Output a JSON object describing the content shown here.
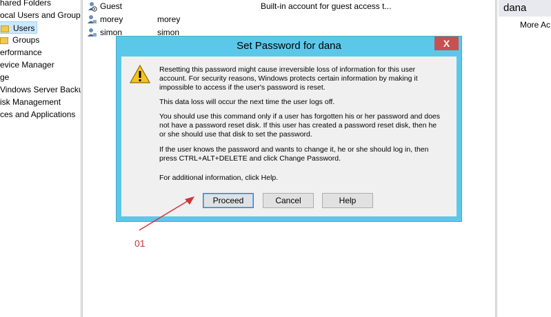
{
  "tree": {
    "items": [
      {
        "label": "hared Folders"
      },
      {
        "label": "ocal Users and Groups"
      },
      {
        "label": "Users"
      },
      {
        "label": "Groups"
      },
      {
        "label": "erformance"
      },
      {
        "label": "evice Manager"
      },
      {
        "label": "ge"
      },
      {
        "label": "Vindows Server Backup"
      },
      {
        "label": "isk Management"
      },
      {
        "label": "ces and Applications"
      }
    ]
  },
  "users": [
    {
      "name": "Guest",
      "full_name": "",
      "description": "Built-in account for guest access t..."
    },
    {
      "name": "morey",
      "full_name": "morey",
      "description": ""
    },
    {
      "name": "simon",
      "full_name": "simon",
      "description": ""
    }
  ],
  "actions": {
    "header": "dana",
    "more": "More Ac"
  },
  "dialog": {
    "title": "Set Password for dana",
    "close": "X",
    "paragraphs": [
      "Resetting this password might cause irreversible loss of information for this user account. For security reasons, Windows protects certain information by making it impossible to access if the user's password is reset.",
      "This data loss will occur the next time the user logs off.",
      "You should use this command only if a user has forgotten his or her password and does not have a password reset disk. If this user has created a password reset disk, then he or she should use that disk to set the password.",
      "If the user knows the password and wants to change it, he or she should log in, then press CTRL+ALT+DELETE and click Change Password.",
      "For additional information, click Help."
    ],
    "buttons": {
      "proceed": "Proceed",
      "cancel": "Cancel",
      "help": "Help"
    },
    "icon": "warning-icon"
  },
  "annotation": {
    "label": "01",
    "color": "#d13438"
  }
}
